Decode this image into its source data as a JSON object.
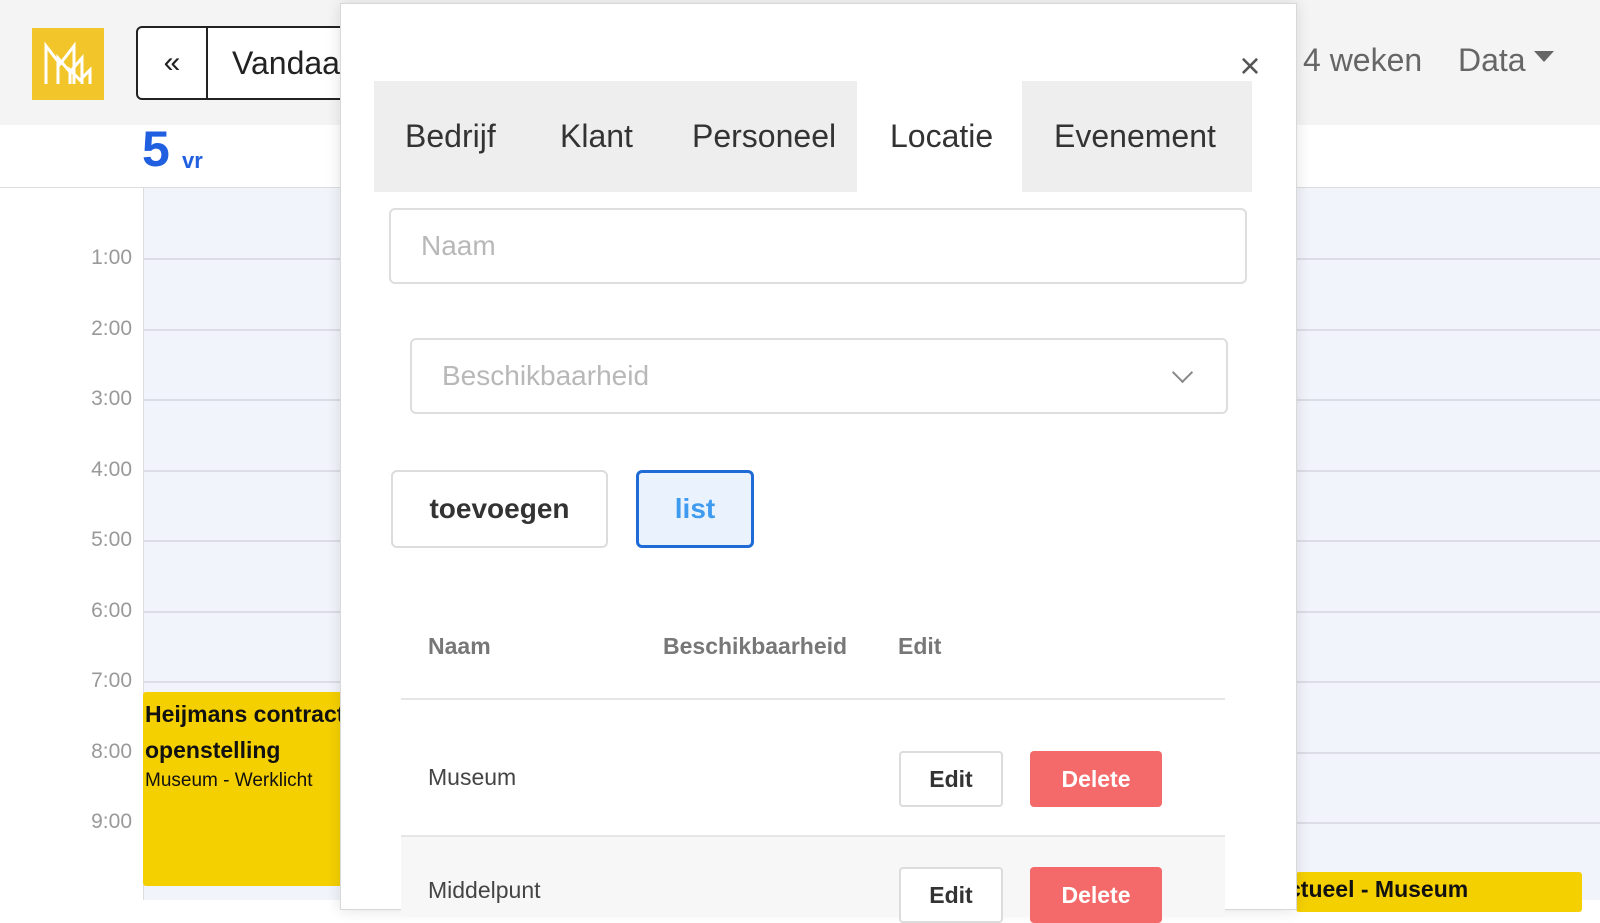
{
  "header": {
    "prev_label": "«",
    "today_label": "Vandaag",
    "view_4weeks": "4 weken",
    "data_menu": "Data"
  },
  "day": {
    "number": "5",
    "name": "vr"
  },
  "hours": [
    "1:00",
    "2:00",
    "3:00",
    "4:00",
    "5:00",
    "6:00",
    "7:00",
    "8:00",
    "9:00"
  ],
  "events": {
    "left": {
      "title_line1": "Heijmans contract",
      "title_line2": "openstelling",
      "subtitle": "Museum - Werklicht"
    },
    "right": {
      "title": "ctueel - Museum"
    }
  },
  "colors": {
    "accent": "#1f5fe0",
    "event": "#f5d000",
    "delete": "#f46a6a",
    "list_border": "#1f6bd6"
  },
  "modal": {
    "close_label": "×",
    "tabs": [
      {
        "label": "Bedrijf",
        "active": false
      },
      {
        "label": "Klant",
        "active": false
      },
      {
        "label": "Personeel",
        "active": false
      },
      {
        "label": "Locatie",
        "active": true
      },
      {
        "label": "Evenement",
        "active": false
      }
    ],
    "naam_placeholder": "Naam",
    "beschikbaarheid_placeholder": "Beschikbaarheid",
    "buttons": {
      "toevoegen": "toevoegen",
      "list": "list"
    },
    "table": {
      "headers": [
        "Naam",
        "Beschikbaarheid",
        "Edit"
      ],
      "rows": [
        {
          "naam": "Museum",
          "edit": "Edit",
          "delete": "Delete"
        },
        {
          "naam": "Middelpunt",
          "edit": "Edit",
          "delete": "Delete"
        }
      ]
    }
  }
}
